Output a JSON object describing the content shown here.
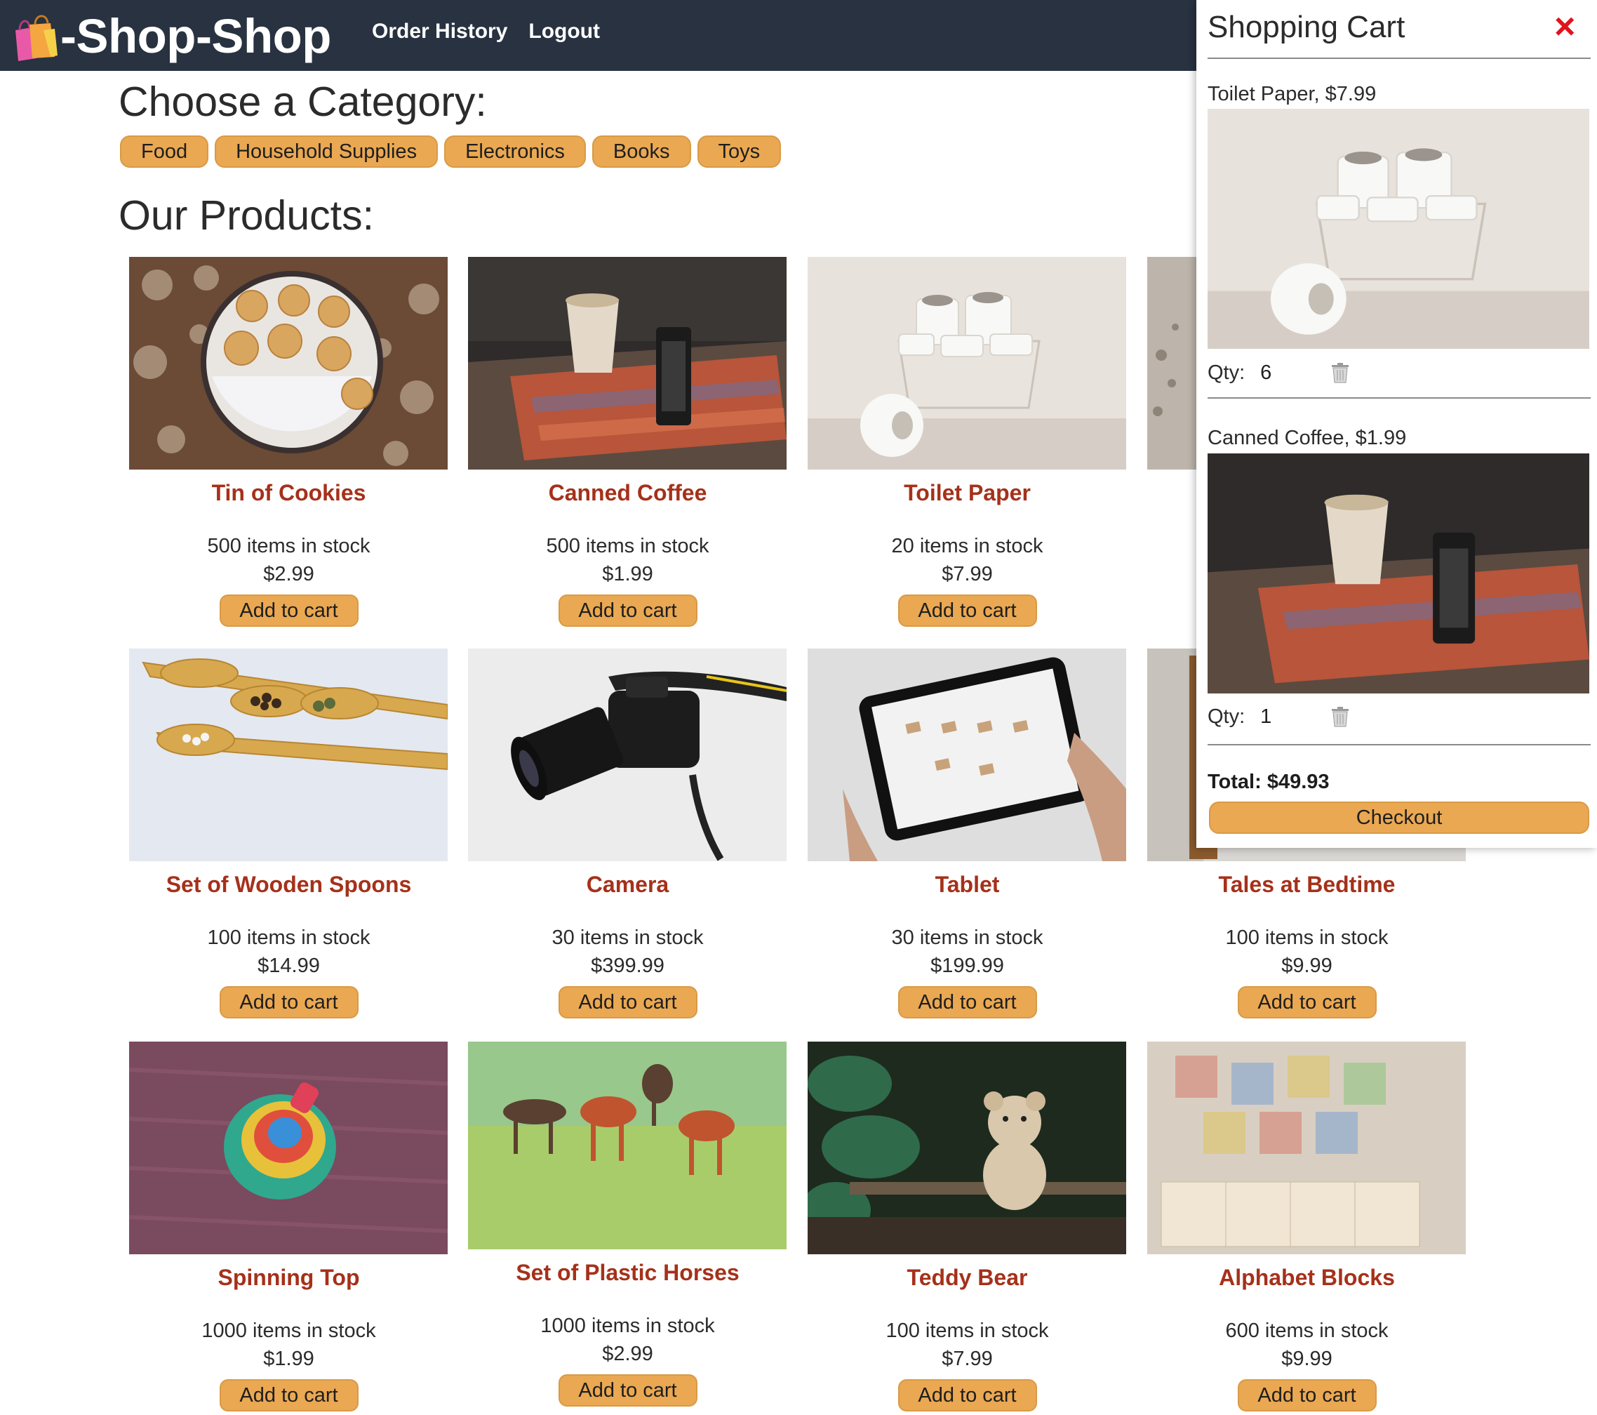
{
  "brand": {
    "name": "-Shop-Shop"
  },
  "nav": {
    "order_history": "Order History",
    "logout": "Logout"
  },
  "categories_title": "Choose a Category:",
  "categories": [
    "Food",
    "Household Supplies",
    "Electronics",
    "Books",
    "Toys"
  ],
  "products_title": "Our Products:",
  "products": [
    {
      "name": "Tin of Cookies",
      "stock": "500 items in stock",
      "price": "$2.99",
      "button": "Add to cart"
    },
    {
      "name": "Canned Coffee",
      "stock": "500 items in stock",
      "price": "$1.99",
      "button": "Add to cart"
    },
    {
      "name": "Toilet Paper",
      "stock": "20 items in stock",
      "price": "$7.99",
      "button": "Add to cart"
    },
    {
      "name": "Set of Wooden Spoons",
      "stock": "100 items in stock",
      "price": "$14.99",
      "button": "Add to cart"
    },
    {
      "name": "Camera",
      "stock": "30 items in stock",
      "price": "$399.99",
      "button": "Add to cart"
    },
    {
      "name": "Tablet",
      "stock": "30 items in stock",
      "price": "$199.99",
      "button": "Add to cart"
    },
    {
      "name": "Tales at Bedtime",
      "stock": "100 items in stock",
      "price": "$9.99",
      "button": "Add to cart"
    },
    {
      "name": "Spinning Top",
      "stock": "1000 items in stock",
      "price": "$1.99",
      "button": "Add to cart"
    },
    {
      "name": "Set of Plastic Horses",
      "stock": "1000 items in stock",
      "price": "$2.99",
      "button": "Add to cart"
    },
    {
      "name": "Teddy Bear",
      "stock": "100 items in stock",
      "price": "$7.99",
      "button": "Add to cart"
    },
    {
      "name": "Alphabet Blocks",
      "stock": "600 items in stock",
      "price": "$9.99",
      "button": "Add to cart"
    }
  ],
  "cart": {
    "title": "Shopping Cart",
    "close_icon": "×",
    "items": [
      {
        "label": "Toilet Paper, $7.99",
        "qty_label": "Qty:",
        "qty": "6"
      },
      {
        "label": "Canned Coffee, $1.99",
        "qty_label": "Qty:",
        "qty": "1"
      }
    ],
    "total": "Total: $49.93",
    "checkout": "Checkout"
  },
  "colors": {
    "navbar": "#283240",
    "accent_button": "#eaa852",
    "product_name": "#a5311a",
    "close_icon": "#e0141a"
  }
}
